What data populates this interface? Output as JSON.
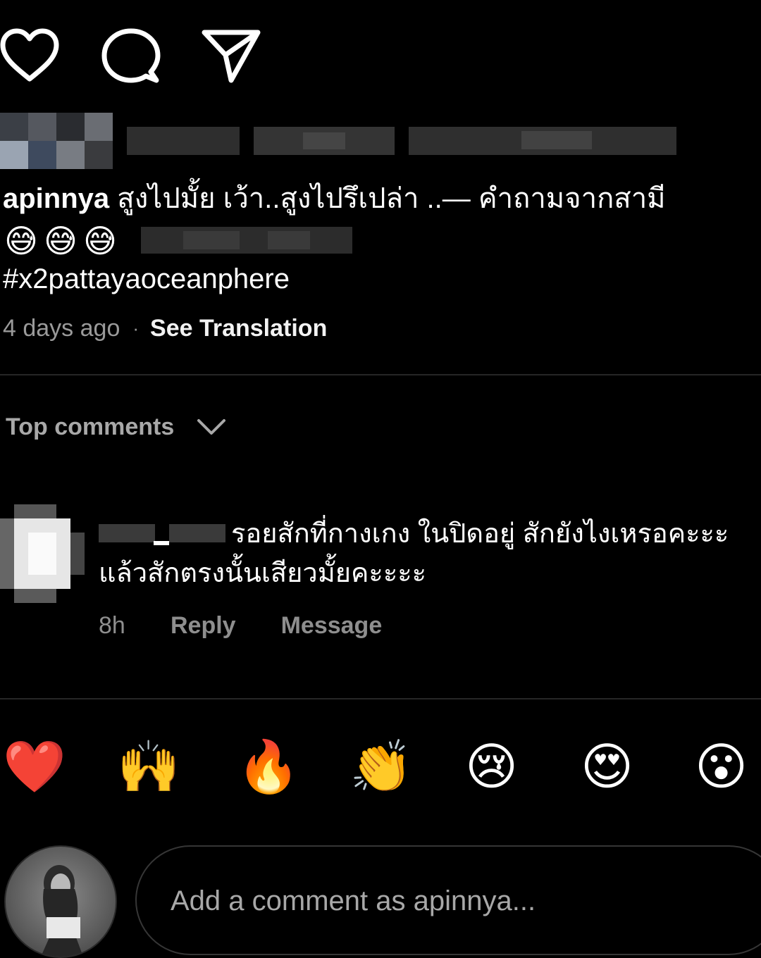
{
  "actions": {
    "like_icon": "heart-outline",
    "comment_icon": "comment-bubble",
    "share_icon": "paper-plane"
  },
  "caption": {
    "username": "apinnya",
    "text_line1": "สูงไปมั้ย เว้า..สูงไปรึเปล่า ..— คำถามจากสามี",
    "emojis": [
      "😅",
      "😅",
      "😅"
    ],
    "hashtag": "#x2pattayaoceanphere"
  },
  "meta": {
    "time": "4 days ago",
    "separator": "·",
    "translate": "See Translation"
  },
  "comments_header": {
    "label": "Top comments"
  },
  "comment": {
    "username_placeholder": "_",
    "text_line1": "รอยสักที่กางเกง ในปิดอยู่ สักยังไงเหรอคะะะ",
    "text_line2": "แล้วสักตรงนั้นเสียวมั้ยคะะะะ",
    "time": "8h",
    "reply": "Reply",
    "message": "Message"
  },
  "reactions": [
    "❤️",
    "🙌",
    "🔥",
    "👏",
    "😢",
    "😍",
    "😮"
  ],
  "composer": {
    "placeholder": "Add a comment as apinnya..."
  },
  "colors": {
    "background": "#000000",
    "text": "#ffffff",
    "secondary_text": "#9a9a9a",
    "divider": "#262626"
  }
}
